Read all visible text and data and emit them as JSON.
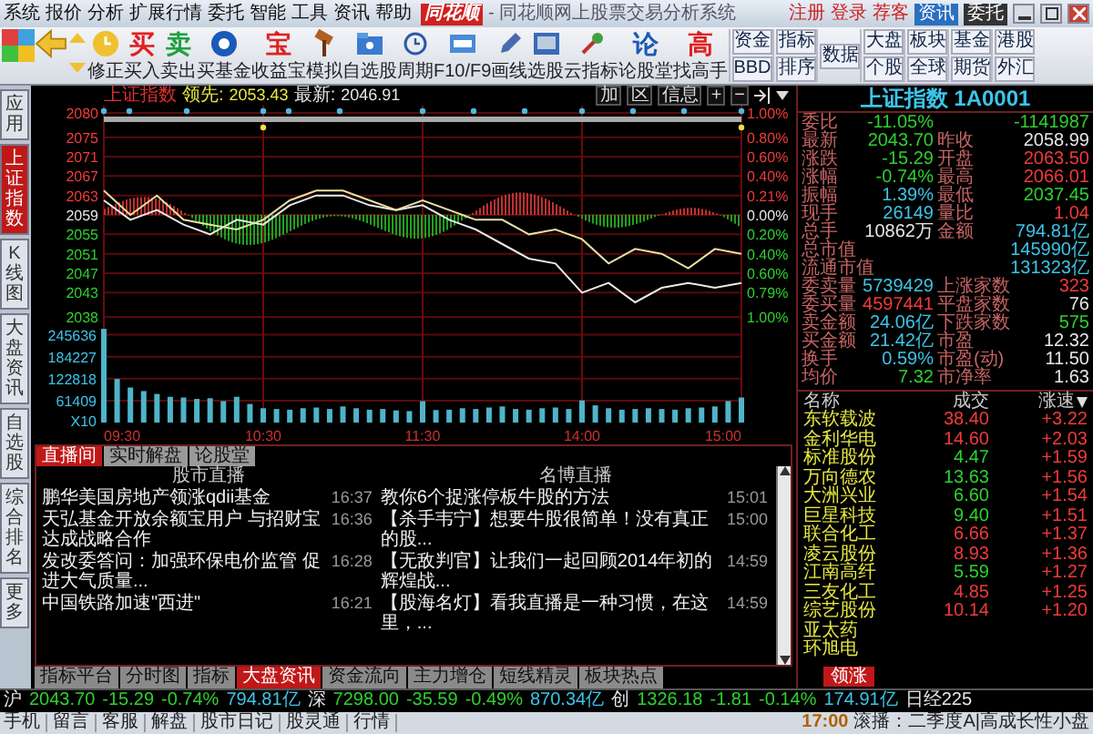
{
  "title_bar": {
    "menu": [
      "系统",
      "报价",
      "分析",
      "扩展行情",
      "委托",
      "智能",
      "工具",
      "资讯",
      "帮助"
    ],
    "logo": "同花顺",
    "title": "- 同花顺网上股票交易分析系统",
    "links": [
      "注册",
      "登录",
      "荐客"
    ],
    "buttons": [
      {
        "label": "资讯",
        "selected": true
      },
      {
        "label": "委托",
        "selected": false
      }
    ]
  },
  "toolbar": {
    "tools": [
      {
        "kind": "icon",
        "label": "修正"
      },
      {
        "kind": "glyph",
        "glyph": "买",
        "color": "#e02020",
        "label": "买入"
      },
      {
        "kind": "glyph",
        "glyph": "卖",
        "color": "#20a040",
        "label": "卖出"
      },
      {
        "kind": "icon",
        "label": "买基金"
      },
      {
        "kind": "glyph",
        "glyph": "宝",
        "color": "#e02020",
        "label": "收益宝"
      },
      {
        "kind": "icon",
        "label": "模拟"
      },
      {
        "kind": "icon",
        "label": "自选股"
      },
      {
        "kind": "icon",
        "label": "周期"
      },
      {
        "kind": "icon",
        "label": "F10/F9"
      },
      {
        "kind": "icon",
        "label": "画线"
      },
      {
        "kind": "icon",
        "label": "选股"
      },
      {
        "kind": "icon",
        "label": "云指标"
      },
      {
        "kind": "glyph",
        "glyph": "论",
        "color": "#1a5ab8",
        "label": "论股堂"
      },
      {
        "kind": "glyph",
        "glyph": "高",
        "color": "#e02020",
        "label": "找高手"
      }
    ],
    "quick_buttons": [
      [
        "资金",
        "BBD"
      ],
      [
        "指标",
        "排序"
      ],
      [
        "数据"
      ],
      [
        "大盘",
        "个股"
      ],
      [
        "板块",
        "全球"
      ],
      [
        "基金",
        "期货"
      ],
      [
        "港股",
        "外汇"
      ]
    ]
  },
  "side_tabs": [
    {
      "label": "应用",
      "selected": false
    },
    {
      "label": "上证指数",
      "selected": true
    },
    {
      "label": "K线图",
      "selected": false
    },
    {
      "label": "大盘资讯",
      "selected": false
    },
    {
      "label": "自选股",
      "selected": false
    },
    {
      "label": "综合排名",
      "selected": false
    },
    {
      "label": "更多",
      "selected": false
    }
  ],
  "price_chart": {
    "name": "上证指数",
    "lead_label": "领先:",
    "lead_value": "2053.43",
    "latest_label": "最新:",
    "latest_value": "2046.91",
    "controls": [
      "加",
      "区",
      "信息",
      "+",
      "−"
    ],
    "chart_data": {
      "type": "line",
      "grid": true,
      "ylim": [
        2038,
        2080
      ],
      "yticks": [
        2038,
        2043,
        2047,
        2051,
        2055,
        2059,
        2063,
        2067,
        2071,
        2075,
        2080
      ],
      "series": [
        {
          "color": "#e8e8e8",
          "values": [
            2062,
            2058,
            2060,
            2057,
            2055,
            2058,
            2057,
            2061,
            2063,
            2063,
            2061,
            2060,
            2061,
            2058,
            2056,
            2053,
            2050,
            2049,
            2043,
            2045,
            2041,
            2044,
            2045,
            2044,
            2045
          ]
        },
        {
          "color": "#e8e0a0",
          "values": [
            2064,
            2059,
            2063,
            2058,
            2057,
            2056,
            2058,
            2062,
            2064,
            2064,
            2062,
            2060,
            2062,
            2060,
            2058,
            2058,
            2055,
            2056,
            2054,
            2049,
            2052,
            2051,
            2048,
            2052,
            2051
          ]
        }
      ]
    },
    "right_axis": [
      {
        "label": "1.00%",
        "color": "#f03a3a"
      },
      {
        "label": "0.80%",
        "color": "#f03a3a"
      },
      {
        "label": "0.60%",
        "color": "#f03a3a"
      },
      {
        "label": "0.40%",
        "color": "#f03a3a"
      },
      {
        "label": "0.21%",
        "color": "#f03a3a"
      },
      {
        "label": "0.00%",
        "color": "#e6e6e6"
      },
      {
        "label": "0.20%",
        "color": "#2ed02e"
      },
      {
        "label": "0.40%",
        "color": "#2ed02e"
      },
      {
        "label": "0.60%",
        "color": "#2ed02e"
      },
      {
        "label": "0.79%",
        "color": "#2ed02e"
      },
      {
        "label": "1.00%",
        "color": "#2ed02e"
      }
    ]
  },
  "volume_chart": {
    "unit_label": "X10",
    "chart_data": {
      "type": "bar",
      "grid": true,
      "ylim": [
        0,
        270000
      ],
      "yticks": [
        61409,
        122818,
        184227,
        245636
      ],
      "series": [
        {
          "color": "#4fb4c8",
          "values": [
            262000,
            122000,
            98000,
            88000,
            80000,
            72000,
            70000,
            66000,
            68000,
            60000,
            72000,
            52000,
            40000,
            38000,
            36000,
            40000,
            42000,
            38000,
            45000,
            40000,
            36000,
            38000,
            34000,
            32000,
            60000,
            35000,
            36000,
            40000,
            38000,
            42000,
            45000,
            38000,
            36000,
            40000,
            42000,
            38000,
            62000,
            48000,
            40000,
            36000,
            38000,
            40000,
            38000,
            36000,
            40000,
            42000,
            45000,
            60000,
            70000
          ]
        }
      ]
    }
  },
  "time_axis": [
    "09:30",
    "10:30",
    "11:30",
    "14:00",
    "15:00"
  ],
  "news": {
    "tabs": [
      {
        "label": "直播间",
        "selected": true
      },
      {
        "label": "实时解盘",
        "selected": false
      },
      {
        "label": "论股堂",
        "selected": false
      }
    ],
    "columns": [
      "股市直播",
      "名博直播"
    ],
    "rows": [
      {
        "left": "鹏华美国房地产领涨qdii基金",
        "left_time": "16:37",
        "right": "教你6个捉涨停板牛股的方法",
        "right_time": "15:01"
      },
      {
        "left": "天弘基金开放余额宝用户 与招财宝达成战略合作",
        "left_time": "16:36",
        "right": "【杀手韦宁】想要牛股很简单！没有真正的股...",
        "right_time": "15:00"
      },
      {
        "left": "发改委答问：加强环保电价监管 促进大气质量...",
        "left_time": "16:28",
        "right": "【无敌判官】让我们一起回顾2014年初的辉煌战...",
        "right_time": "14:59"
      },
      {
        "left": "中国铁路加速\"西进\"",
        "left_time": "16:21",
        "right": "【股海名灯】看我直播是一种习惯，在这里，...",
        "right_time": "14:59"
      }
    ]
  },
  "bottom_tabs": [
    {
      "label": "指标平台",
      "selected": false
    },
    {
      "label": "分时图",
      "selected": false
    },
    {
      "label": "指标",
      "selected": false
    },
    {
      "label": "大盘资讯",
      "selected": true
    },
    {
      "label": "资金流向",
      "selected": false
    },
    {
      "label": "主力增仓",
      "selected": false
    },
    {
      "label": "短线精灵",
      "selected": false
    },
    {
      "label": "板块热点",
      "selected": false
    }
  ],
  "quote_panel": {
    "title": "上证指数 1A0001",
    "rows": [
      {
        "cells": [
          {
            "label": "委比",
            "value": "-11.05%",
            "color": "#2ed02e"
          },
          {
            "value": "-1141987",
            "color": "#2ed02e"
          }
        ]
      },
      {
        "cells": [
          {
            "label": "最新",
            "value": "2043.70",
            "color": "#2ed02e"
          },
          {
            "label": "昨收",
            "value": "2058.99",
            "color": "#e6e6e6"
          }
        ]
      },
      {
        "cells": [
          {
            "label": "涨跌",
            "value": "-15.29",
            "color": "#2ed02e"
          },
          {
            "label": "开盘",
            "value": "2063.50",
            "color": "#f03a3a"
          }
        ]
      },
      {
        "cells": [
          {
            "label": "涨幅",
            "value": "-0.74%",
            "color": "#2ed02e"
          },
          {
            "label": "最高",
            "value": "2066.01",
            "color": "#f03a3a"
          }
        ]
      },
      {
        "cells": [
          {
            "label": "振幅",
            "value": "1.39%",
            "color": "#3cc4e8"
          },
          {
            "label": "最低",
            "value": "2037.45",
            "color": "#2ed02e"
          }
        ]
      },
      {
        "cells": [
          {
            "label": "现手",
            "value": "26149",
            "color": "#3cc4e8"
          },
          {
            "label": "量比",
            "value": "1.04",
            "color": "#f03a3a"
          }
        ]
      },
      {
        "cells": [
          {
            "label": "总手",
            "value": "10862万",
            "color": "#e6e6e6"
          },
          {
            "label": "金额",
            "value": "794.81亿",
            "color": "#3cc4e8"
          }
        ]
      },
      {
        "cells": [
          {
            "label": "总市值",
            "value": "145990亿",
            "color": "#3cc4e8"
          }
        ]
      },
      {
        "cells": [
          {
            "label": "流通市值",
            "value": "131323亿",
            "color": "#3cc4e8"
          }
        ]
      },
      {
        "cells": [
          {
            "label": "委卖量",
            "value": "5739429",
            "color": "#3cc4e8"
          },
          {
            "label": "上涨家数",
            "value": "323",
            "color": "#f03a3a"
          }
        ]
      },
      {
        "cells": [
          {
            "label": "委买量",
            "value": "4597441",
            "color": "#f03a3a"
          },
          {
            "label": "平盘家数",
            "value": "76",
            "color": "#e6e6e6"
          }
        ]
      },
      {
        "cells": [
          {
            "label": "卖金额",
            "value": "24.06亿",
            "color": "#3cc4e8"
          },
          {
            "label": "下跌家数",
            "value": "575",
            "color": "#2ed02e"
          }
        ]
      },
      {
        "cells": [
          {
            "label": "买金额",
            "value": "21.42亿",
            "color": "#3cc4e8"
          },
          {
            "label": "市盈",
            "value": "12.32",
            "color": "#e6e6e6"
          }
        ]
      },
      {
        "cells": [
          {
            "label": "换手",
            "value": "0.59%",
            "color": "#3cc4e8"
          },
          {
            "label": "市盈(动)",
            "value": "11.50",
            "color": "#e6e6e6"
          }
        ]
      },
      {
        "cells": [
          {
            "label": "均价",
            "value": "7.32",
            "color": "#2ed02e"
          },
          {
            "label": "市净率",
            "value": "1.63",
            "color": "#e6e6e6"
          }
        ]
      }
    ]
  },
  "stock_list": {
    "columns": [
      "名称",
      "成交",
      "涨速"
    ],
    "rows": [
      {
        "name": "东软载波",
        "price": "38.40",
        "color": "#f03a3a",
        "speed": "+3.22"
      },
      {
        "name": "金利华电",
        "price": "14.60",
        "color": "#f03a3a",
        "speed": "+2.03"
      },
      {
        "name": "标准股份",
        "price": "4.47",
        "color": "#2ed02e",
        "speed": "+1.59"
      },
      {
        "name": "万向德农",
        "price": "13.63",
        "color": "#2ed02e",
        "speed": "+1.56"
      },
      {
        "name": "大洲兴业",
        "price": "6.60",
        "color": "#2ed02e",
        "speed": "+1.54"
      },
      {
        "name": "巨星科技",
        "price": "9.40",
        "color": "#2ed02e",
        "speed": "+1.51"
      },
      {
        "name": "联合化工",
        "price": "6.66",
        "color": "#f03a3a",
        "speed": "+1.37"
      },
      {
        "name": "凌云股份",
        "price": "8.93",
        "color": "#f03a3a",
        "speed": "+1.36"
      },
      {
        "name": "江南高纤",
        "price": "5.59",
        "color": "#2ed02e",
        "speed": "+1.27"
      },
      {
        "name": "三友化工",
        "price": "4.85",
        "color": "#f03a3a",
        "speed": "+1.25"
      },
      {
        "name": "综艺股份",
        "price": "10.14",
        "color": "#f03a3a",
        "speed": "+1.20"
      },
      {
        "name": "亚太药"
      },
      {
        "name": "环旭电"
      }
    ],
    "tab": {
      "label": "领涨",
      "selected": true
    }
  },
  "status_bar": {
    "ticker": [
      {
        "text": "沪",
        "color": "#e6e6e6"
      },
      {
        "text": "2043.70",
        "color": "#2ed02e"
      },
      {
        "text": "-15.29",
        "color": "#2ed02e"
      },
      {
        "text": "-0.74%",
        "color": "#2ed02e"
      },
      {
        "text": "794.81亿",
        "color": "#3cc4e8"
      },
      {
        "text": "深",
        "color": "#e6e6e6"
      },
      {
        "text": "7298.00",
        "color": "#2ed02e"
      },
      {
        "text": "-35.59",
        "color": "#2ed02e"
      },
      {
        "text": "-0.49%",
        "color": "#2ed02e"
      },
      {
        "text": "870.34亿",
        "color": "#3cc4e8"
      },
      {
        "text": "创",
        "color": "#e6e6e6"
      },
      {
        "text": "1326.18",
        "color": "#2ed02e"
      },
      {
        "text": "-1.81",
        "color": "#2ed02e"
      },
      {
        "text": "-0.14%",
        "color": "#2ed02e"
      },
      {
        "text": "174.91亿",
        "color": "#3cc4e8"
      },
      {
        "text": "日经225",
        "color": "#e6e6e6"
      }
    ],
    "links": [
      "手机",
      "留言",
      "客服",
      "解盘",
      "股市日记",
      "股灵通",
      "行情"
    ],
    "news_time": "17:00",
    "news_text": "滚播：二季度A|高成长性小盘"
  }
}
